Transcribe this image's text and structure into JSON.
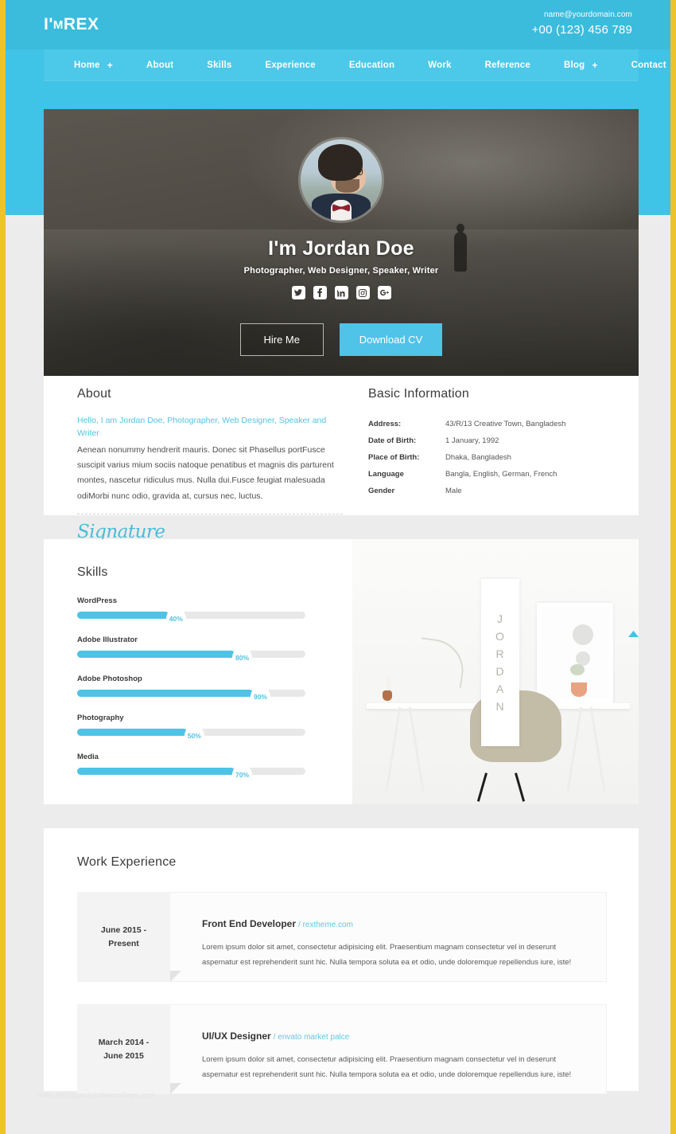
{
  "theme": {
    "accent": "#4fc3e8",
    "band": "#3fc3e6",
    "border": "#ecc32b"
  },
  "header": {
    "logo_prefix": "I'",
    "logo_m": "M",
    "logo_rest": "REX",
    "email": "name@yourdomain.com",
    "phone": "+00 (123) 456 789"
  },
  "nav": {
    "items": [
      {
        "label": "Home",
        "plus": "+"
      },
      {
        "label": "About",
        "plus": ""
      },
      {
        "label": "Skills",
        "plus": ""
      },
      {
        "label": "Experience",
        "plus": ""
      },
      {
        "label": "Education",
        "plus": ""
      },
      {
        "label": "Work",
        "plus": ""
      },
      {
        "label": "Reference",
        "plus": ""
      },
      {
        "label": "Blog",
        "plus": "+"
      },
      {
        "label": "Contact",
        "plus": ""
      }
    ]
  },
  "hero": {
    "name": "I'm Jordan Doe",
    "role": "Photographer, Web Designer, Speaker, Writer",
    "socials": [
      {
        "icon": "twitter-icon",
        "glyph": "t"
      },
      {
        "icon": "facebook-icon",
        "glyph": "f"
      },
      {
        "icon": "linkedin-icon",
        "glyph": "in"
      },
      {
        "icon": "instagram-icon",
        "glyph": "o"
      },
      {
        "icon": "google-plus-icon",
        "glyph": "G+"
      }
    ],
    "hire_button": "Hire Me",
    "download_button": "Download CV"
  },
  "about": {
    "title": "About",
    "lead": "Hello, I am Jordan Doe, Photographer, Web Designer, Speaker and Writer",
    "body": "Aenean nonummy hendrerit mauris. Donec sit Phasellus portFusce suscipit varius mium sociis natoque penatibus et magnis dis parturent montes, nascetur ridiculus mus. Nulla dui.Fusce feugiat malesuada odiMorbi nunc odio, gravida at, cursus nec, luctus.",
    "signature": "Signature"
  },
  "basic_information": {
    "title": "Basic Information",
    "rows": [
      {
        "label": "Address:",
        "value": "43/R/13 Creative Town, Bangladesh"
      },
      {
        "label": "Date of Birth:",
        "value": "1 January, 1992"
      },
      {
        "label": "Place of Birth:",
        "value": "Dhaka, Bangladesh"
      },
      {
        "label": "Language",
        "value": "Bangla, English, German, French"
      },
      {
        "label": "Gender",
        "value": "Male"
      }
    ]
  },
  "skills": {
    "title": "Skills",
    "items": [
      {
        "name": "WordPress",
        "percent_label": "40%",
        "fill": 40
      },
      {
        "name": "Adobe Illustrator",
        "percent_label": "80%",
        "fill": 69
      },
      {
        "name": "Adobe Photoshop",
        "percent_label": "90%",
        "fill": 77
      },
      {
        "name": "Photography",
        "percent_label": "50%",
        "fill": 48
      },
      {
        "name": "Media",
        "percent_label": "70%",
        "fill": 69
      }
    ],
    "photo_poster_letters": [
      "J",
      "O",
      "R",
      "D",
      "A",
      "N"
    ]
  },
  "work": {
    "title": "Work Experience",
    "items": [
      {
        "date": "June 2015 - Present",
        "role": "Front End Developer",
        "company": "/ rextheme.com",
        "description": "Lorem ipsum dolor sit amet, consectetur adipisicing elit. Praesentium magnam consectetur vel in deserunt aspernatur est reprehenderit sunt hic. Nulla tempora soluta ea et odio, unde doloremque repellendus iure, iste!"
      },
      {
        "date": "March 2014 - June 2015",
        "role": "UI/UX Designer",
        "company": "/ envato market palce",
        "description": "Lorem ipsum dolor sit amet, consectetur adipisicing elit. Praesentium magnam consectetur vel in deserunt aspernatur est reprehenderit sunt hic. Nulla tempora soluta ea et odio, unde doloremque repellendus iure, iste!"
      }
    ]
  },
  "watermark": "www.heritagechristiancollege.com"
}
